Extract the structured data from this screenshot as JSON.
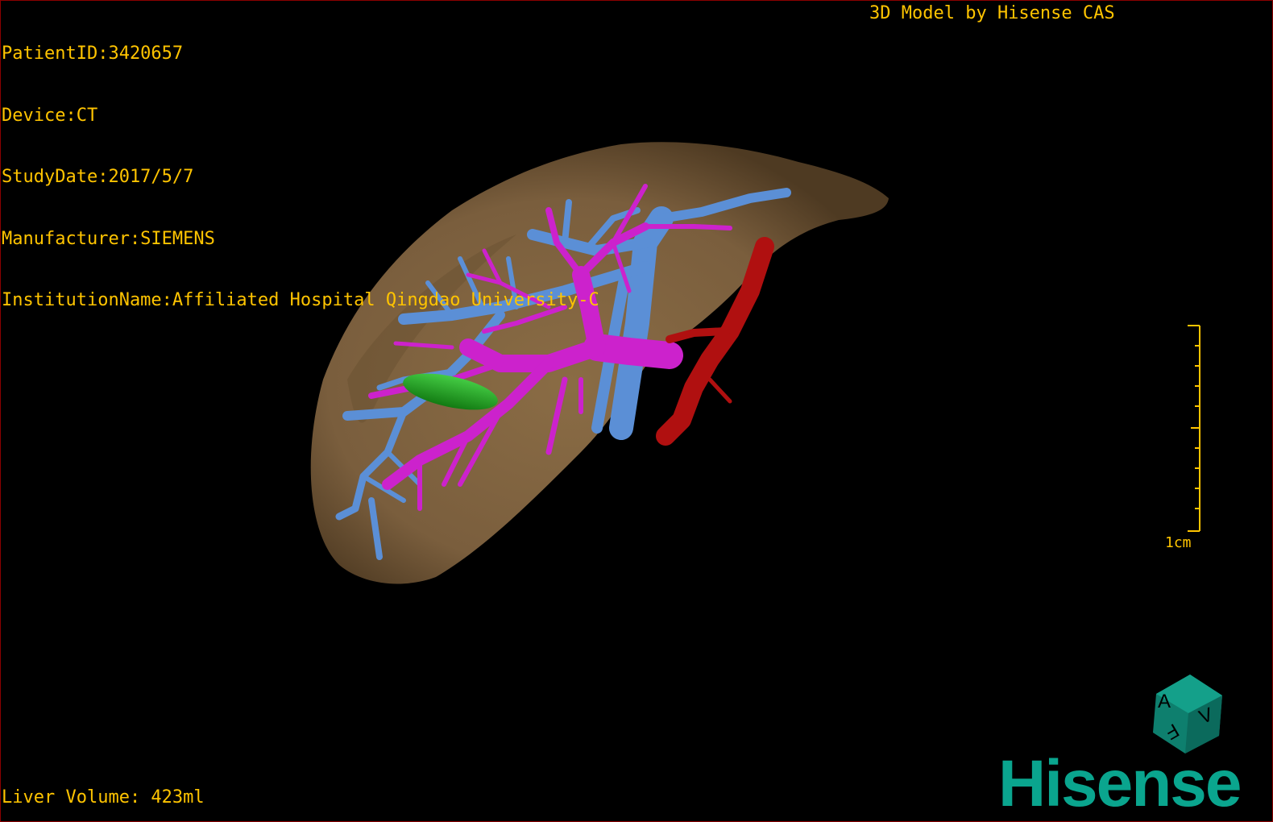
{
  "study": {
    "patient_id": "PatientID:3420657",
    "device": "Device:CT",
    "study_date": "StudyDate:2017/5/7",
    "manufacturer": "Manufacturer:SIEMENS",
    "institution": "InstitutionName:Affiliated Hospital Qingdao University-C"
  },
  "brand_text": "3D Model by Hisense CAS",
  "liver_volume": "Liver Volume: 423ml",
  "scale_bar": {
    "label": "1cm"
  },
  "orientation_cube": {
    "face_labels": [
      "A",
      "F",
      "V"
    ],
    "color": "#0e7f6e"
  },
  "logo": {
    "text": "Hisense",
    "color": "#0aa58e"
  },
  "model_colors": {
    "liver": "#7d6240",
    "hepatic_vein": "#5b8fd6",
    "portal_vein": "#cc22cc",
    "artery": "#b01010",
    "gallbladder": "#22a322"
  },
  "overlay_color": "#ffc400"
}
